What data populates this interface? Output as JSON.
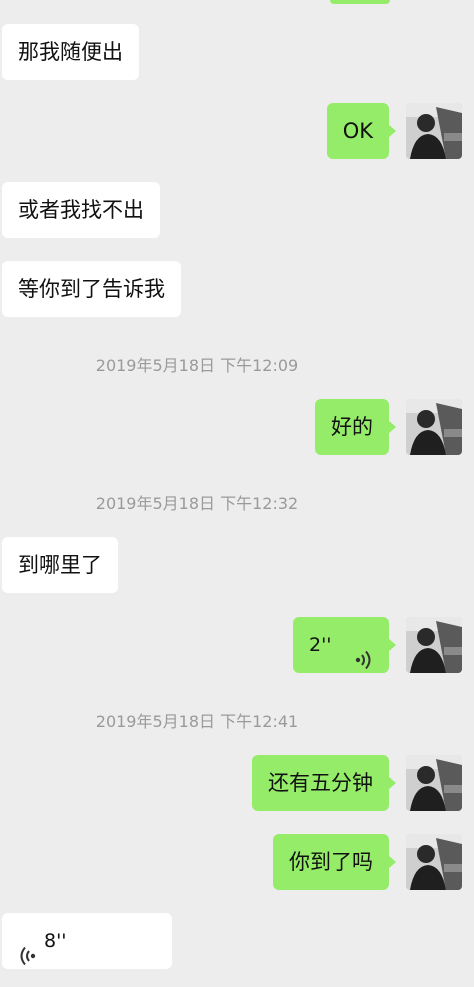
{
  "messages": [
    {
      "side": "in",
      "text": "那我随便出"
    },
    {
      "side": "out",
      "text": "OK"
    },
    {
      "side": "in",
      "text": "或者我找不出"
    },
    {
      "side": "in",
      "text": "等你到了告诉我"
    },
    {
      "time": "2019年5月18日 下午12:09"
    },
    {
      "side": "out",
      "text": "好的"
    },
    {
      "time": "2019年5月18日 下午12:32"
    },
    {
      "side": "in",
      "text": "到哪里了"
    },
    {
      "side": "out",
      "voice": "2''"
    },
    {
      "time": "2019年5月18日 下午12:41"
    },
    {
      "side": "out",
      "text": "还有五分钟"
    },
    {
      "side": "out",
      "text": "你到了吗"
    },
    {
      "side": "in",
      "voice": "8''"
    }
  ],
  "colors": {
    "background": "#ededed",
    "incoming_bubble": "#ffffff",
    "outgoing_bubble": "#95ec69",
    "timestamp_text": "#9a9a9a"
  },
  "icons": {
    "avatar": "user-avatar-photo",
    "voice": "voice-wave-icon"
  }
}
